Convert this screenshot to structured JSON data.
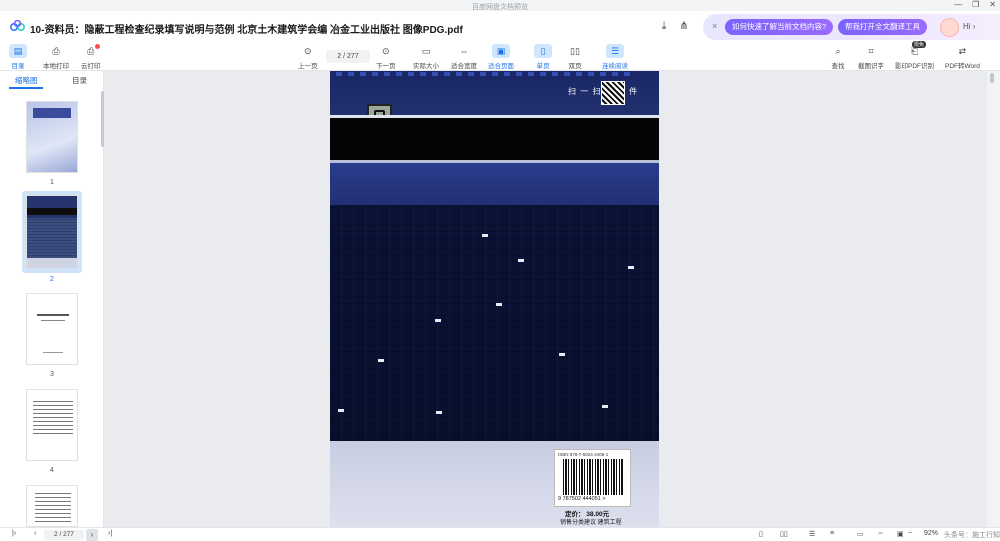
{
  "window": {
    "title": "百度网盘文档预览",
    "controls": [
      "—",
      "❐",
      "✕"
    ]
  },
  "header": {
    "doc_title": "10-资料员：隐蔽工程检查纪录填写说明与范例 北京土木建筑学会编 冶金工业出版社 图像PDG.pdf",
    "download_icon": "download-icon",
    "share_icon": "share-icon"
  },
  "ai": {
    "close": "×",
    "prompt1": "如何快速了解当前文档内容?",
    "prompt2": "帮我打开全文翻译工具",
    "greeting": "Hi ›"
  },
  "toolbar": {
    "catalog": "目录",
    "local_print": "本地打印",
    "cloud_print": "云打印",
    "prev_page": "上一页",
    "page_indicator": "2 / 277",
    "next_page": "下一页",
    "actual_size": "实际大小",
    "fit_width": "适合宽度",
    "fit_page": "适合页面",
    "single_page": "单页",
    "double_page": "双页",
    "continuous": "连续阅读",
    "search": "查找",
    "screenshot_ocr": "截图识字",
    "pdf_ocr": "影印PDF识别",
    "pdf_to_word": "PDF转Word",
    "new_tag": "限免"
  },
  "sidebar": {
    "tabs": [
      "缩略图",
      "目录"
    ],
    "pages": [
      "1",
      "2",
      "3",
      "4"
    ]
  },
  "page": {
    "scan_text": "扫 一 扫          版 读 件",
    "isbn": "ISBN 978-7-5024-4405-1",
    "barcode_digits": "9 787502 444051 >",
    "price": "定价：  38.00元",
    "category": "销售分类建议 建筑工程"
  },
  "status": {
    "page_indicator": "2 / 277",
    "zoom": "92%",
    "watermark": "头条号：施工行知",
    "first": "|‹",
    "prev": "‹",
    "next": "›",
    "last": "›|"
  },
  "colors": {
    "accent": "#1a73e8",
    "ai_pill": "#7a63ff",
    "cover_blue": "#1f2b63",
    "cover_grid": "#3a4d7d"
  }
}
